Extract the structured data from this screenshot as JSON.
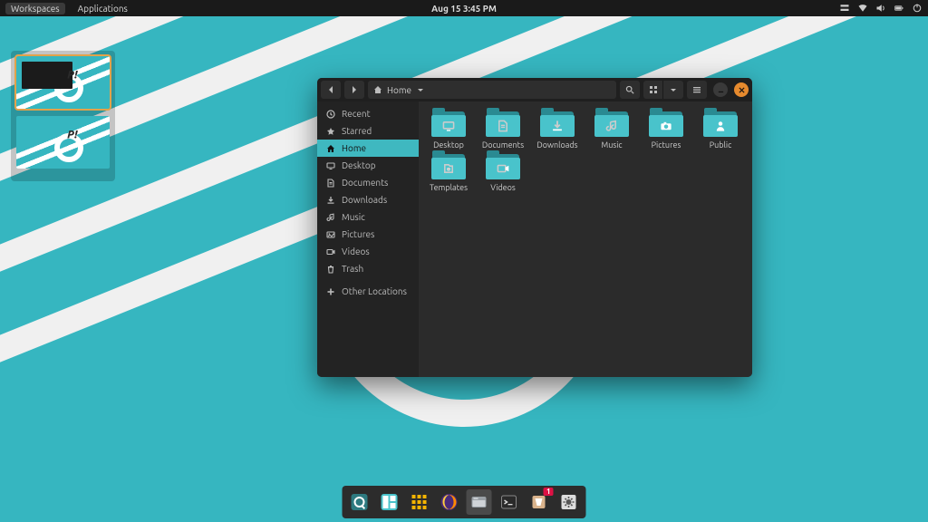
{
  "topbar": {
    "workspaces_label": "Workspaces",
    "applications_label": "Applications",
    "datetime": "Aug 15  3:45 PM",
    "tray_icons": [
      "dropdown",
      "network",
      "volume",
      "battery",
      "power"
    ]
  },
  "workspace_switcher": {
    "thumbs": [
      "ws1",
      "ws2"
    ],
    "active_index": 0,
    "logo_text": "P!"
  },
  "dock": {
    "apps": [
      {
        "name": "pop-shop",
        "active": false
      },
      {
        "name": "tiling",
        "active": false
      },
      {
        "name": "app-grid",
        "active": false
      },
      {
        "name": "firefox",
        "active": false
      },
      {
        "name": "files",
        "active": true
      },
      {
        "name": "terminal",
        "active": false
      },
      {
        "name": "updater",
        "active": false,
        "badge": "1"
      },
      {
        "name": "settings",
        "active": false
      }
    ]
  },
  "file_manager": {
    "path_label": "Home",
    "toolbar": {
      "back": "back",
      "forward": "forward",
      "search": "search",
      "view_grid": "grid",
      "view_dropdown": "dropdown",
      "hamburger": "menu",
      "minimize": "minimize",
      "close": "close"
    },
    "sidebar": [
      {
        "icon": "clock",
        "label": "Recent"
      },
      {
        "icon": "star",
        "label": "Starred"
      },
      {
        "icon": "home",
        "label": "Home",
        "active": true
      },
      {
        "icon": "desktop",
        "label": "Desktop"
      },
      {
        "icon": "document",
        "label": "Documents"
      },
      {
        "icon": "download",
        "label": "Downloads"
      },
      {
        "icon": "music",
        "label": "Music"
      },
      {
        "icon": "picture",
        "label": "Pictures"
      },
      {
        "icon": "video",
        "label": "Videos"
      },
      {
        "icon": "trash",
        "label": "Trash"
      },
      {
        "icon": "plus",
        "label": "Other Locations"
      }
    ],
    "folders": [
      {
        "icon": "desktop",
        "label": "Desktop"
      },
      {
        "icon": "document",
        "label": "Documents"
      },
      {
        "icon": "download",
        "label": "Downloads"
      },
      {
        "icon": "music",
        "label": "Music"
      },
      {
        "icon": "picture",
        "label": "Pictures"
      },
      {
        "icon": "public",
        "label": "Public"
      },
      {
        "icon": "template",
        "label": "Templates"
      },
      {
        "icon": "video",
        "label": "Videos"
      }
    ]
  },
  "colors": {
    "accent": "#49c3cb",
    "accent_dark": "#2a8a92",
    "window": "#2b2b2b",
    "close": "#e68a2e"
  }
}
